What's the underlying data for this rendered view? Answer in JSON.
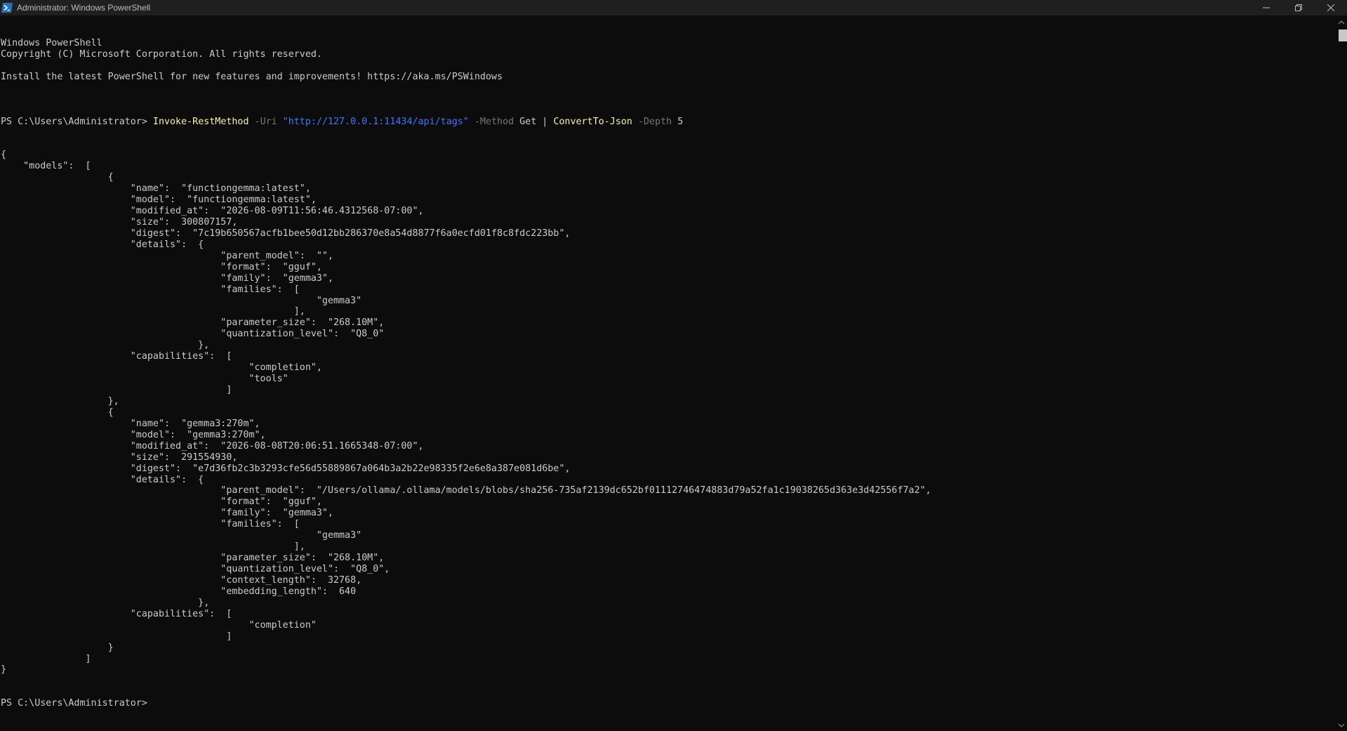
{
  "window": {
    "title": "Administrator: Windows PowerShell",
    "controls": {
      "minimize_icon": "minimize-icon",
      "restore_icon": "restore-icon",
      "close_icon": "close-icon"
    }
  },
  "colors": {
    "background": "#0c0c0c",
    "text": "#cccccc",
    "command": "#f9f1a5",
    "parameter": "#767676",
    "string": "#3b78ff"
  },
  "terminal": {
    "banner": [
      "Windows PowerShell",
      "Copyright (C) Microsoft Corporation. All rights reserved.",
      "",
      "Install the latest PowerShell for new features and improvements! https://aka.ms/PSWindows",
      ""
    ],
    "command_line": {
      "prompt": "PS C:\\Users\\Administrator> ",
      "cmdlet": "Invoke-RestMethod",
      "param_uri": " -Uri ",
      "uri_value": "\"http://127.0.0.1:11434/api/tags\"",
      "param_method": " -Method",
      "method_value": " Get | ",
      "cmdlet2": "ConvertTo-Json",
      "param_depth": " -Depth",
      "depth_value": " 5"
    },
    "output": [
      "{",
      "    \"models\":  [",
      "                   {",
      "                       \"name\":  \"functiongemma:latest\",",
      "                       \"model\":  \"functiongemma:latest\",",
      "                       \"modified_at\":  \"2026-08-09T11:56:46.4312568-07:00\",",
      "                       \"size\":  300807157,",
      "                       \"digest\":  \"7c19b650567acfb1bee50d12bb286370e8a54d8877f6a0ecfd01f8c8fdc223bb\",",
      "                       \"details\":  {",
      "                                       \"parent_model\":  \"\",",
      "                                       \"format\":  \"gguf\",",
      "                                       \"family\":  \"gemma3\",",
      "                                       \"families\":  [",
      "                                                        \"gemma3\"",
      "                                                    ],",
      "                                       \"parameter_size\":  \"268.10M\",",
      "                                       \"quantization_level\":  \"Q8_0\"",
      "                                   },",
      "                       \"capabilities\":  [",
      "                                            \"completion\",",
      "                                            \"tools\"",
      "                                        ]",
      "                   },",
      "                   {",
      "                       \"name\":  \"gemma3:270m\",",
      "                       \"model\":  \"gemma3:270m\",",
      "                       \"modified_at\":  \"2026-08-08T20:06:51.1665348-07:00\",",
      "                       \"size\":  291554930,",
      "                       \"digest\":  \"e7d36fb2c3b3293cfe56d55889867a064b3a2b22e98335f2e6e8a387e081d6be\",",
      "                       \"details\":  {",
      "                                       \"parent_model\":  \"/Users/ollama/.ollama/models/blobs/sha256-735af2139dc652bf01112746474883d79a52fa1c19038265d363e3d42556f7a2\",",
      "                                       \"format\":  \"gguf\",",
      "                                       \"family\":  \"gemma3\",",
      "                                       \"families\":  [",
      "                                                        \"gemma3\"",
      "                                                    ],",
      "                                       \"parameter_size\":  \"268.10M\",",
      "                                       \"quantization_level\":  \"Q8_0\",",
      "                                       \"context_length\":  32768,",
      "                                       \"embedding_length\":  640",
      "                                   },",
      "                       \"capabilities\":  [",
      "                                            \"completion\"",
      "                                        ]",
      "                   }",
      "               ]",
      "}"
    ],
    "final_prompt": "PS C:\\Users\\Administrator> "
  },
  "scrollbar": {
    "up_icon": "chevron-up-icon",
    "down_icon": "chevron-down-icon"
  }
}
